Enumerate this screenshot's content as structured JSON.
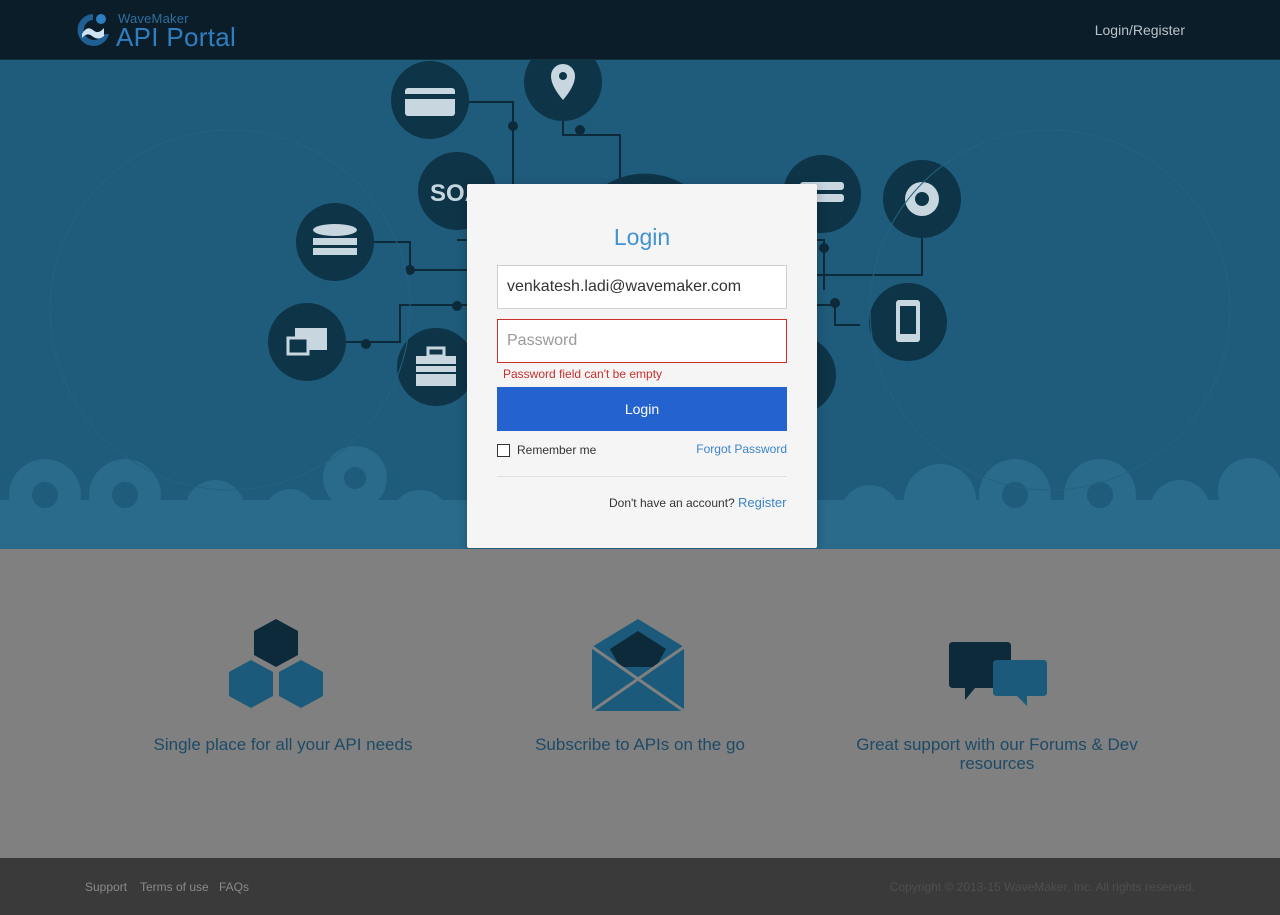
{
  "header": {
    "logo_small": "WaveMaker",
    "logo_big": "API Portal",
    "nav_login": "Login/Register"
  },
  "hero": {
    "badge_text": "SOA"
  },
  "login": {
    "title": "Login",
    "email_value": "venkatesh.ladi@wavemaker.com",
    "password_placeholder": "Password",
    "password_error": "Password field can't be empty",
    "login_button": "Login",
    "remember_label": "Remember me",
    "forgot_label": "Forgot Password",
    "no_account_text": "Don't have an account?",
    "register_label": "Register"
  },
  "features": [
    {
      "icon": "hexagons-icon",
      "text": "Single place for all your API needs"
    },
    {
      "icon": "envelope-icon",
      "text": "Subscribe to APIs on the go"
    },
    {
      "icon": "chat-bubbles-icon",
      "text": "Great support with our Forums & Dev resources"
    }
  ],
  "footer": {
    "links": [
      "Support",
      "Terms of use",
      "FAQs"
    ],
    "copyright": "Copyright © 2013-15 WaveMaker, Inc. All rights reserved."
  },
  "colors": {
    "header_bg": "#0b1d28",
    "hero_bg": "#1f5b7b",
    "accent": "#4193cf",
    "button": "#2462d0",
    "error": "#c9302c",
    "feature_text": "#1e4a66",
    "footer_bg": "#3a3a3a"
  }
}
